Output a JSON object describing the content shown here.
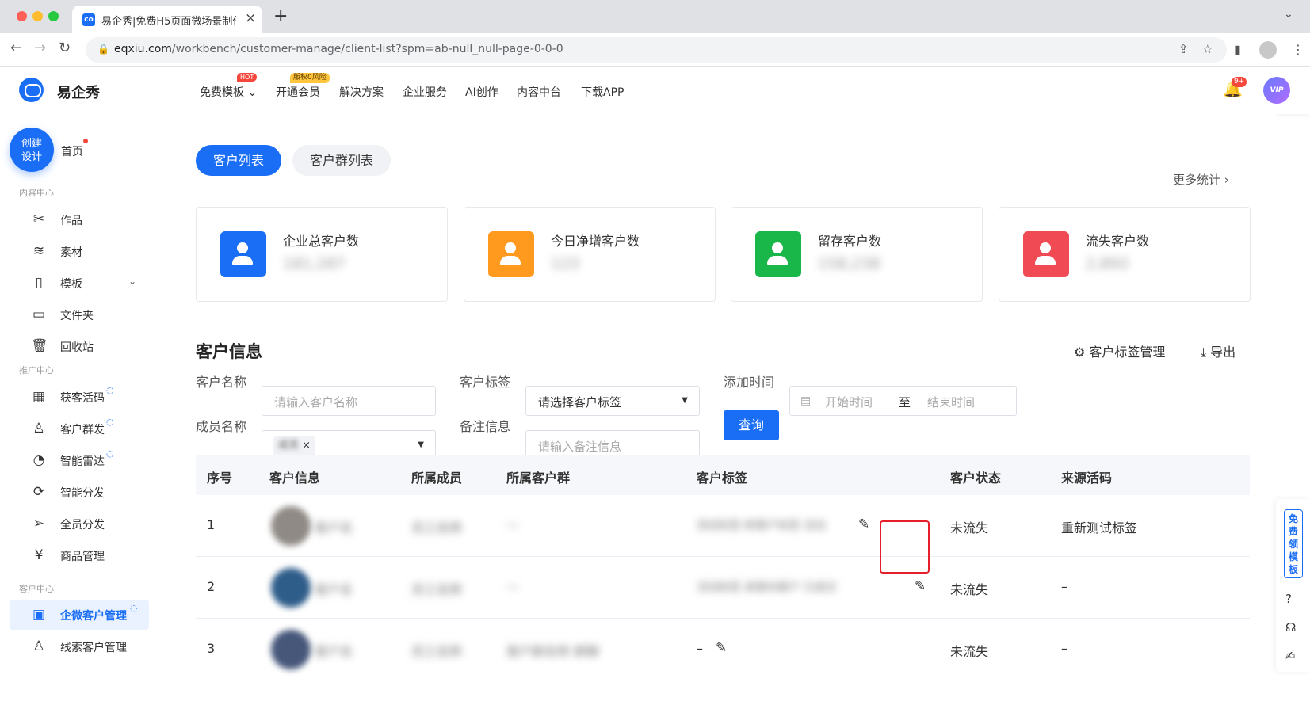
{
  "browser": {
    "tab_title": "易企秀|免费H5页面微场景制作工具",
    "tab_favicon": "co",
    "url_host": "eqxiu.com",
    "url_path": "/workbench/customer-manage/client-list?spm=ab-null_null-page-0-0-0"
  },
  "header": {
    "logo_text": "易企秀",
    "nav": [
      {
        "label": "免费模板 ⌄"
      },
      {
        "label": "开通会员"
      },
      {
        "label": "解决方案"
      },
      {
        "label": "企业服务"
      },
      {
        "label": "AI创作"
      },
      {
        "label": "内容中台"
      },
      {
        "label": "下载APP"
      }
    ],
    "hot_badge": "HOT",
    "risk_badge": "版权0风险",
    "bell_count": "9+",
    "vip_label": "VIP"
  },
  "sidebar": {
    "create_line1": "创建",
    "create_line2": "设计",
    "home": "首页",
    "sections": {
      "content": "内容中心",
      "promo": "推广中心",
      "customer": "客户中心"
    },
    "items": [
      {
        "label": "作品",
        "icon": "works-icon"
      },
      {
        "label": "素材",
        "icon": "layers-icon"
      },
      {
        "label": "模板",
        "icon": "template-icon"
      },
      {
        "label": "文件夹",
        "icon": "folder-icon"
      },
      {
        "label": "回收站",
        "icon": "trash-icon"
      },
      {
        "label": "获客活码",
        "icon": "qrcode-icon"
      },
      {
        "label": "客户群发",
        "icon": "user-send-icon"
      },
      {
        "label": "智能雷达",
        "icon": "radar-icon"
      },
      {
        "label": "智能分发",
        "icon": "distribute-icon"
      },
      {
        "label": "全员分发",
        "icon": "paper-plane-icon"
      },
      {
        "label": "商品管理",
        "icon": "goods-icon"
      },
      {
        "label": "企微客户管理",
        "icon": "contact-card-icon"
      },
      {
        "label": "线索客户管理",
        "icon": "lead-user-icon"
      }
    ]
  },
  "main": {
    "tab_active": "客户列表",
    "tab_inactive": "客户群列表",
    "more_stats": "更多统计  ›",
    "stats": [
      {
        "title": "企业总客户数",
        "value": "181,287",
        "color": "#1a6ef5"
      },
      {
        "title": "今日净增客户数",
        "value": "123",
        "color": "#ff9a1f"
      },
      {
        "title": "留存客户数",
        "value": "158,238",
        "color": "#19b64a"
      },
      {
        "title": "流失客户数",
        "value": "2,893",
        "color": "#f04b55"
      }
    ],
    "section_title": "客户信息",
    "tag_manage": "⚙ 客户标签管理",
    "export": "⤓ 导出",
    "filters": {
      "name_label": "客户名称",
      "name_placeholder": "请输入客户名称",
      "tag_label": "客户标签",
      "tag_value": "请选择客户标签",
      "time_label": "添加时间",
      "start_placeholder": "开始时间",
      "range_sep": "至",
      "end_placeholder": "结束时间",
      "member_label": "成员名称",
      "member_chip": "成员",
      "remark_label": "备注信息",
      "remark_placeholder": "请输入备注信息",
      "query": "查询"
    },
    "table": {
      "headers": [
        "序号",
        "客户信息",
        "所属成员",
        "所属客户群",
        "客户标签",
        "客户状态",
        "来源活码"
      ],
      "rows": [
        {
          "no": "1",
          "info": "客户名",
          "member": "员工名称",
          "group": "—",
          "tag": "测试标签 新客户标签 活动",
          "status": "未流失",
          "source": "重新测试标签"
        },
        {
          "no": "2",
          "info": "客户名",
          "member": "员工名称",
          "group": "—",
          "tag": "活动标签 高意向客户 已成交",
          "status": "未流失",
          "source": "–"
        },
        {
          "no": "3",
          "info": "客户名",
          "member": "员工名称",
          "group": "客户群名称 群聊",
          "tag": "–",
          "status": "未流失",
          "source": "–"
        }
      ]
    }
  },
  "rightbar": {
    "free_template": "免费领模板"
  }
}
